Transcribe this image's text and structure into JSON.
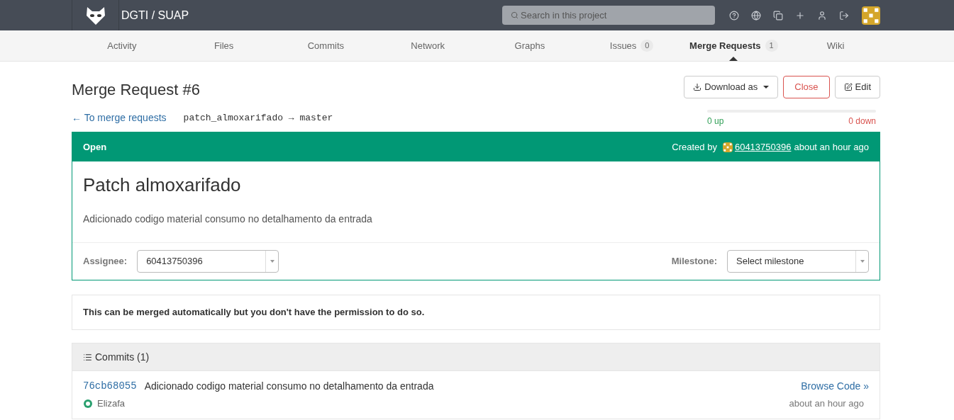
{
  "header": {
    "project": "DGTI / SUAP",
    "search": {
      "placeholder": "Search in this project"
    }
  },
  "tabs": [
    {
      "label": "Activity",
      "selected": false
    },
    {
      "label": "Files",
      "selected": false
    },
    {
      "label": "Commits",
      "selected": false
    },
    {
      "label": "Network",
      "selected": false
    },
    {
      "label": "Graphs",
      "selected": false
    },
    {
      "label": "Issues",
      "count": "0",
      "selected": false
    },
    {
      "label": "Merge Requests",
      "count": "1",
      "selected": true
    },
    {
      "label": "Wiki",
      "selected": false
    }
  ],
  "title": "Merge Request #6",
  "back_link": "← To merge requests",
  "branches": "patch_almoxarifado → master",
  "actions": {
    "download": "Download as",
    "close": "Close",
    "edit": "Edit"
  },
  "votes": {
    "up": "0 up",
    "down": "0 down"
  },
  "merge_request": {
    "status": "Open",
    "created_by": "Created by",
    "author": "60413750396",
    "time": "about an hour ago",
    "heading": "Patch almoxarifado",
    "description": "Adicionado codigo material consumo no detalhamento da entrada",
    "assignee_label": "Assignee:",
    "assignee": "60413750396",
    "milestone_label": "Milestone:",
    "milestone_placeholder": "Select milestone"
  },
  "merge_notice": "This can be merged automatically but you don't have the permission to do so.",
  "commits": {
    "title": "Commits (1)",
    "items": [
      {
        "sha": "76cb68055",
        "message": "Adicionado codigo material consumo no detalhamento da entrada",
        "author": "Elizafa",
        "browse": "Browse Code »",
        "time": "about an hour ago"
      }
    ]
  }
}
